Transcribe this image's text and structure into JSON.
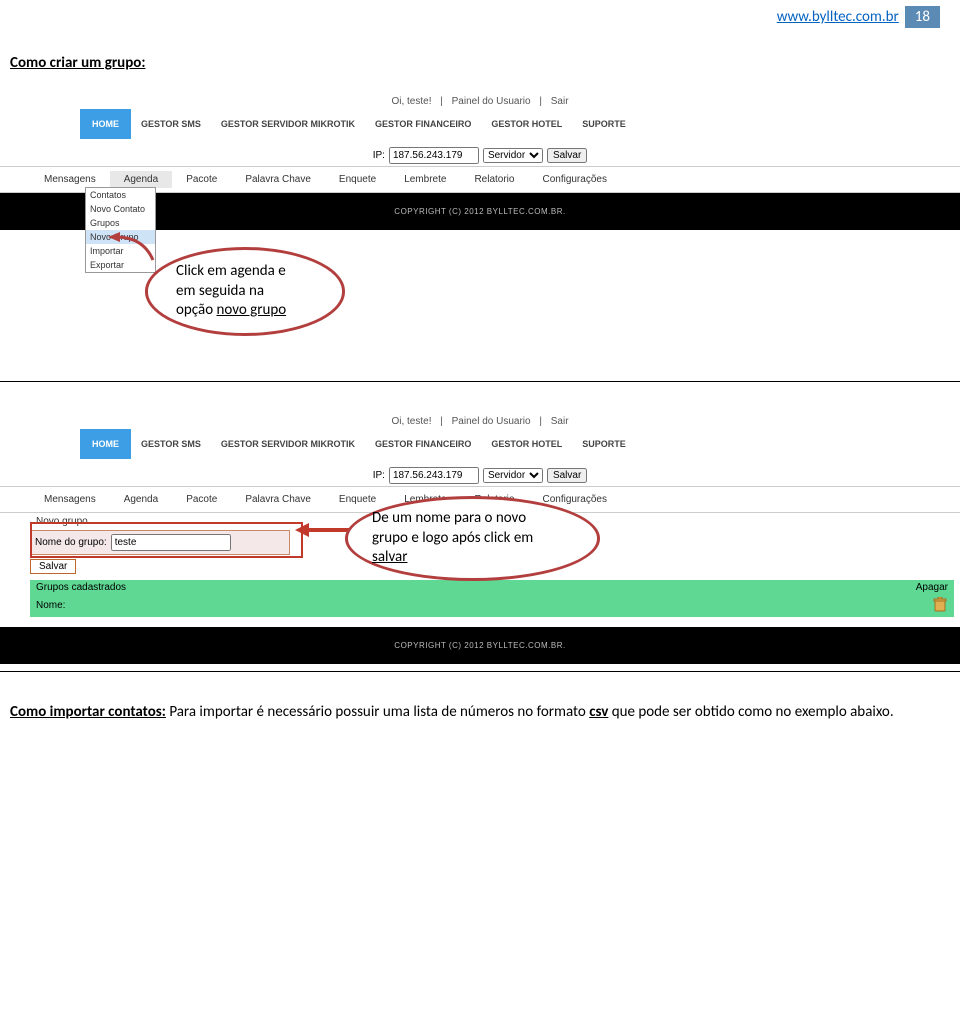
{
  "header": {
    "url": "www.bylltec.com.br",
    "page": "18"
  },
  "section1_title": "Como criar um grupo:",
  "screenshot_common": {
    "greeting": "Oi, teste!",
    "user_panel": "Painel do Usuario",
    "logout": "Sair",
    "nav": {
      "home": "HOME",
      "sms": "GESTOR SMS",
      "mikrotik": "GESTOR SERVIDOR MIKROTIK",
      "fin": "GESTOR FINANCEIRO",
      "hotel": "GESTOR HOTEL",
      "suporte": "SUPORTE"
    },
    "ip": {
      "label": "IP:",
      "value": "187.56.243.179",
      "select": "Servidor",
      "save": "Salvar"
    },
    "subnav": {
      "mensagens": "Mensagens",
      "agenda": "Agenda",
      "pacote": "Pacote",
      "palavra": "Palavra Chave",
      "enquete": "Enquete",
      "lembrete": "Lembrete",
      "relatorio": "Relatorio",
      "config": "Configurações"
    },
    "copyright": "COPYRIGHT (C) 2012 BYLLTEC.COM.BR."
  },
  "dropdown": {
    "contatos": "Contatos",
    "novo_contato": "Novo Contato",
    "grupos": "Grupos",
    "novo_grupo": "Novo Grupo",
    "importar": "Importar",
    "exportar": "Exportar"
  },
  "callout1": {
    "l1": "Click em agenda e",
    "l2": "em seguida na",
    "l3_a": "opção ",
    "l3_b": "novo grupo"
  },
  "ss2": {
    "novo_grupo": "Novo grupo",
    "nome_label": "Nome do grupo:",
    "nome_value": "teste",
    "salvar": "Salvar",
    "grupos_cad": "Grupos cadastrados",
    "apagar": "Apagar",
    "nome": "Nome:"
  },
  "callout2": {
    "l1": "De um nome para o novo",
    "l2": "grupo e logo após click em",
    "l3": "salvar"
  },
  "body": {
    "t1": "Como importar contatos:",
    "t2": " Para importar é necessário possuir uma lista de números no formato ",
    "t3": "csv",
    "t4": " que pode ser obtido como no exemplo abaixo."
  }
}
